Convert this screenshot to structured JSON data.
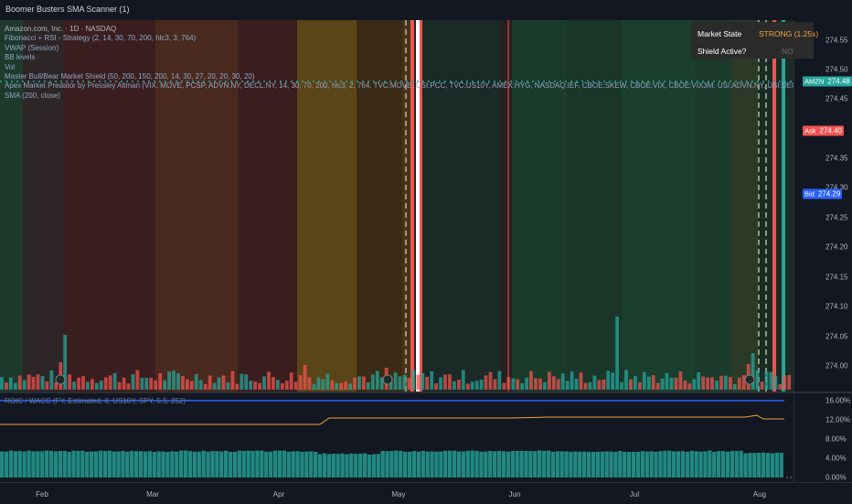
{
  "window": {
    "title": "Boomer Busters SMA Scanner (1)"
  },
  "legend": {
    "symbol": "Amazon.com, Inc. · 1D · NASDAQ",
    "lines": [
      "Fibonacci + RSI - Strategy (2, 14, 30, 70, 200, hlc3, 3, 764)",
      "VWAP (Session)",
      "BB levels",
      "Vol",
      "Master Bull/Bear Market Shield (50, 200, 150, 200, 14, 30, 27, 20, 20, 30, 20)",
      "Apex Market Predator by Pressley Altman (VIX, MOVE, PCSP, ADVN.NY, DECL.NY, 14, 30, 70, 200, hlc3, 2, 764, TVC:MOVE, USI:PCC, TVC:US10Y, AMEX:HYG, NASDAQ:IEF, CBOE:SKEW, CBOE:VIX, CBOE:VIX3M, USI:ADVN.NY, USI:DECL.NY)",
      "SMA (200, close)"
    ]
  },
  "market_state": {
    "state_label": "Market State",
    "state_value": "STRONG (1.25x)",
    "shield_label": "Shield Active?",
    "shield_value": "NO"
  },
  "price_axis": {
    "ticks": [
      "274.55",
      "274.50",
      "274.45",
      "274.35",
      "274.30",
      "274.25",
      "274.20",
      "274.15",
      "274.10",
      "274.05",
      "274.00"
    ],
    "hidden_tick": "274.40"
  },
  "price_tags": {
    "symbol_tag": {
      "label": "AMZN",
      "value": "274.48"
    },
    "ask_tag": {
      "label": "Ask",
      "value": "274.40"
    },
    "bid_tag": {
      "label": "Bid",
      "value": "274.29"
    }
  },
  "lower_pane": {
    "title": "ROIC / WACC (FY, Estimated, 8, US10Y, SPY, 5.5, 252)",
    "ticks": [
      "16.00%",
      "12.00%",
      "8.00%",
      "4.00%",
      "0.00%"
    ]
  },
  "time_axis": {
    "months": [
      "Feb",
      "Mar",
      "Apr",
      "May",
      "Jun",
      "Jul",
      "Aug"
    ]
  },
  "colors": {
    "bull": "#26a69a",
    "bear": "#ef5350",
    "blue": "#2962ff",
    "orange": "#f7a23b",
    "background": "#131722"
  }
}
